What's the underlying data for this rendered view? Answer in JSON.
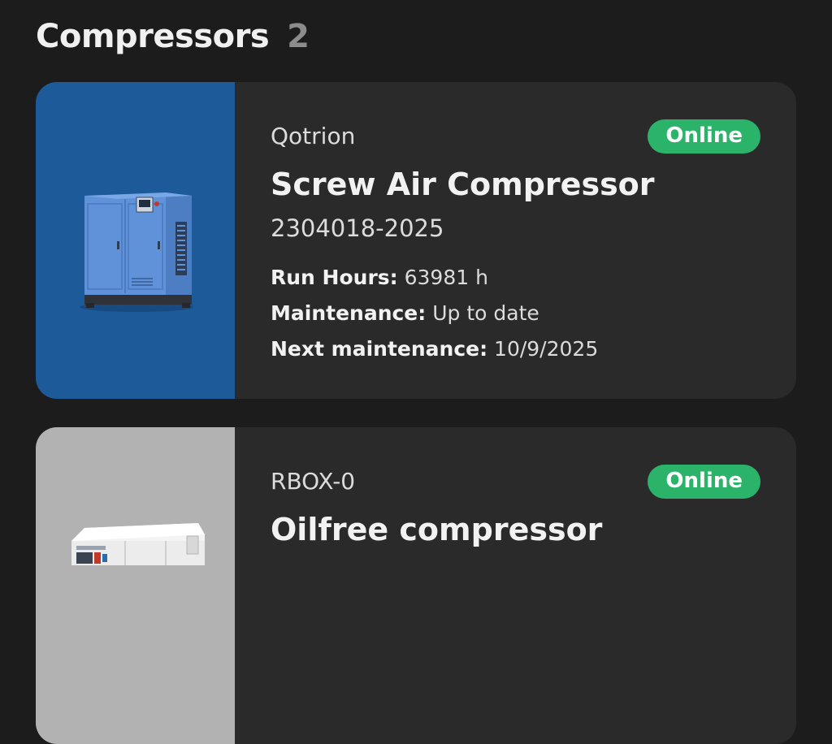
{
  "header": {
    "title": "Compressors",
    "count": "2"
  },
  "colors": {
    "background": "#1c1c1c",
    "card": "#2a2a2a",
    "online_badge": "#2bb36a",
    "thumb_blue": "#1d5a99",
    "thumb_gray": "#b2b2b2"
  },
  "cards": [
    {
      "brand": "Qotrion",
      "status": "Online",
      "name": "Screw Air Compressor",
      "serial": "2304018-2025",
      "run_hours_label": "Run Hours:",
      "run_hours_value": "63981 h",
      "maintenance_label": "Maintenance:",
      "maintenance_value": "Up to date",
      "next_label": "Next maintenance:",
      "next_value": "10/9/2025",
      "image_icon": "screw-compressor-image"
    },
    {
      "brand": "RBOX-0",
      "status": "Online",
      "name": "Oilfree compressor",
      "image_icon": "oilfree-compressor-image"
    }
  ]
}
